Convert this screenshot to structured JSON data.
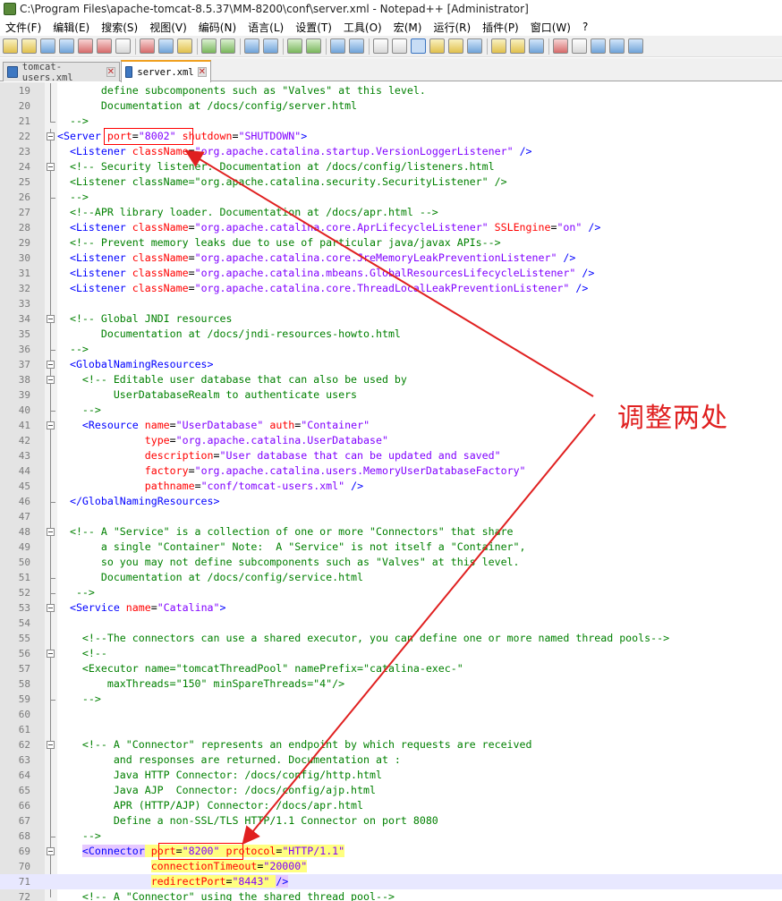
{
  "window": {
    "title": "C:\\Program Files\\apache-tomcat-8.5.37\\MM-8200\\conf\\server.xml - Notepad++ [Administrator]"
  },
  "menu": [
    "文件(F)",
    "编辑(E)",
    "搜索(S)",
    "视图(V)",
    "编码(N)",
    "语言(L)",
    "设置(T)",
    "工具(O)",
    "宏(M)",
    "运行(R)",
    "插件(P)",
    "窗口(W)",
    "?"
  ],
  "toolbar": {
    "icons": [
      "new-file-icon",
      "open-file-icon",
      "save-icon",
      "save-all-icon",
      "close-icon",
      "close-all-icon",
      "print-icon",
      "cut-icon",
      "copy-icon",
      "paste-icon",
      "undo-icon",
      "redo-icon",
      "find-icon",
      "replace-icon",
      "zoom-in-icon",
      "zoom-out-icon",
      "sync-vertical-icon",
      "sync-horizontal-icon",
      "word-wrap-icon",
      "show-all-chars-icon",
      "indent-guide-icon",
      "udl-icon",
      "doc-map-icon",
      "function-list-icon",
      "folder-workspace-icon",
      "monitoring-icon",
      "eye-icon",
      "record-macro-icon",
      "stop-macro-icon",
      "play-macro-icon",
      "run-macro-multiple-icon",
      "save-macro-icon"
    ]
  },
  "tabs": [
    {
      "label": "tomcat-users.xml",
      "active": false
    },
    {
      "label": "server.xml",
      "active": true
    }
  ],
  "editor": {
    "lines": [
      {
        "n": "19",
        "tokens": [
          {
            "t": "c",
            "v": "       define subcomponents such as \"Valves\" at this level."
          }
        ]
      },
      {
        "n": "20",
        "tokens": [
          {
            "t": "c",
            "v": "       Documentation at /docs/config/server.html"
          }
        ]
      },
      {
        "n": "21",
        "tokens": [
          {
            "t": "c",
            "v": "  -->"
          }
        ]
      },
      {
        "n": "22",
        "tokens": [
          {
            "t": "g",
            "v": "<Server"
          },
          {
            "t": "p",
            "v": " "
          },
          {
            "t": "a",
            "v": "port"
          },
          {
            "t": "p",
            "v": "="
          },
          {
            "t": "v",
            "v": "\"8002\""
          },
          {
            "t": "p",
            "v": " "
          },
          {
            "t": "a",
            "v": "shutdown"
          },
          {
            "t": "p",
            "v": "="
          },
          {
            "t": "v",
            "v": "\"SHUTDOWN\""
          },
          {
            "t": "g",
            "v": ">"
          }
        ]
      },
      {
        "n": "23",
        "tokens": [
          {
            "t": "p",
            "v": "  "
          },
          {
            "t": "g",
            "v": "<Listener"
          },
          {
            "t": "p",
            "v": " "
          },
          {
            "t": "a",
            "v": "className"
          },
          {
            "t": "p",
            "v": "="
          },
          {
            "t": "v",
            "v": "\"org.apache.catalina.startup.VersionLoggerListener\""
          },
          {
            "t": "p",
            "v": " "
          },
          {
            "t": "g",
            "v": "/>"
          }
        ]
      },
      {
        "n": "24",
        "tokens": [
          {
            "t": "c",
            "v": "  <!-- Security listener. Documentation at /docs/config/listeners.html"
          }
        ]
      },
      {
        "n": "25",
        "tokens": [
          {
            "t": "c",
            "v": "  <Listener className=\"org.apache.catalina.security.SecurityListener\" />"
          }
        ]
      },
      {
        "n": "26",
        "tokens": [
          {
            "t": "c",
            "v": "  -->"
          }
        ]
      },
      {
        "n": "27",
        "tokens": [
          {
            "t": "c",
            "v": "  <!--APR library loader. Documentation at /docs/apr.html -->"
          }
        ]
      },
      {
        "n": "28",
        "tokens": [
          {
            "t": "p",
            "v": "  "
          },
          {
            "t": "g",
            "v": "<Listener"
          },
          {
            "t": "p",
            "v": " "
          },
          {
            "t": "a",
            "v": "className"
          },
          {
            "t": "p",
            "v": "="
          },
          {
            "t": "v",
            "v": "\"org.apache.catalina.core.AprLifecycleListener\""
          },
          {
            "t": "p",
            "v": " "
          },
          {
            "t": "a",
            "v": "SSLEngine"
          },
          {
            "t": "p",
            "v": "="
          },
          {
            "t": "v",
            "v": "\"on\""
          },
          {
            "t": "p",
            "v": " "
          },
          {
            "t": "g",
            "v": "/>"
          }
        ]
      },
      {
        "n": "29",
        "tokens": [
          {
            "t": "c",
            "v": "  <!-- Prevent memory leaks due to use of particular java/javax APIs-->"
          }
        ]
      },
      {
        "n": "30",
        "tokens": [
          {
            "t": "p",
            "v": "  "
          },
          {
            "t": "g",
            "v": "<Listener"
          },
          {
            "t": "p",
            "v": " "
          },
          {
            "t": "a",
            "v": "className"
          },
          {
            "t": "p",
            "v": "="
          },
          {
            "t": "v",
            "v": "\"org.apache.catalina.core.JreMemoryLeakPreventionListener\""
          },
          {
            "t": "p",
            "v": " "
          },
          {
            "t": "g",
            "v": "/>"
          }
        ]
      },
      {
        "n": "31",
        "tokens": [
          {
            "t": "p",
            "v": "  "
          },
          {
            "t": "g",
            "v": "<Listener"
          },
          {
            "t": "p",
            "v": " "
          },
          {
            "t": "a",
            "v": "className"
          },
          {
            "t": "p",
            "v": "="
          },
          {
            "t": "v",
            "v": "\"org.apache.catalina.mbeans.GlobalResourcesLifecycleListener\""
          },
          {
            "t": "p",
            "v": " "
          },
          {
            "t": "g",
            "v": "/>"
          }
        ]
      },
      {
        "n": "32",
        "tokens": [
          {
            "t": "p",
            "v": "  "
          },
          {
            "t": "g",
            "v": "<Listener"
          },
          {
            "t": "p",
            "v": " "
          },
          {
            "t": "a",
            "v": "className"
          },
          {
            "t": "p",
            "v": "="
          },
          {
            "t": "v",
            "v": "\"org.apache.catalina.core.ThreadLocalLeakPreventionListener\""
          },
          {
            "t": "p",
            "v": " "
          },
          {
            "t": "g",
            "v": "/>"
          }
        ]
      },
      {
        "n": "33",
        "tokens": []
      },
      {
        "n": "34",
        "tokens": [
          {
            "t": "c",
            "v": "  <!-- Global JNDI resources"
          }
        ]
      },
      {
        "n": "35",
        "tokens": [
          {
            "t": "c",
            "v": "       Documentation at /docs/jndi-resources-howto.html"
          }
        ]
      },
      {
        "n": "36",
        "tokens": [
          {
            "t": "c",
            "v": "  -->"
          }
        ]
      },
      {
        "n": "37",
        "tokens": [
          {
            "t": "p",
            "v": "  "
          },
          {
            "t": "g",
            "v": "<GlobalNamingResources>"
          }
        ]
      },
      {
        "n": "38",
        "tokens": [
          {
            "t": "c",
            "v": "    <!-- Editable user database that can also be used by"
          }
        ]
      },
      {
        "n": "39",
        "tokens": [
          {
            "t": "c",
            "v": "         UserDatabaseRealm to authenticate users"
          }
        ]
      },
      {
        "n": "40",
        "tokens": [
          {
            "t": "c",
            "v": "    -->"
          }
        ]
      },
      {
        "n": "41",
        "tokens": [
          {
            "t": "p",
            "v": "    "
          },
          {
            "t": "g",
            "v": "<Resource"
          },
          {
            "t": "p",
            "v": " "
          },
          {
            "t": "a",
            "v": "name"
          },
          {
            "t": "p",
            "v": "="
          },
          {
            "t": "v",
            "v": "\"UserDatabase\""
          },
          {
            "t": "p",
            "v": " "
          },
          {
            "t": "a",
            "v": "auth"
          },
          {
            "t": "p",
            "v": "="
          },
          {
            "t": "v",
            "v": "\"Container\""
          }
        ]
      },
      {
        "n": "42",
        "tokens": [
          {
            "t": "p",
            "v": "              "
          },
          {
            "t": "a",
            "v": "type"
          },
          {
            "t": "p",
            "v": "="
          },
          {
            "t": "v",
            "v": "\"org.apache.catalina.UserDatabase\""
          }
        ]
      },
      {
        "n": "43",
        "tokens": [
          {
            "t": "p",
            "v": "              "
          },
          {
            "t": "a",
            "v": "description"
          },
          {
            "t": "p",
            "v": "="
          },
          {
            "t": "v",
            "v": "\"User database that can be updated and saved\""
          }
        ]
      },
      {
        "n": "44",
        "tokens": [
          {
            "t": "p",
            "v": "              "
          },
          {
            "t": "a",
            "v": "factory"
          },
          {
            "t": "p",
            "v": "="
          },
          {
            "t": "v",
            "v": "\"org.apache.catalina.users.MemoryUserDatabaseFactory\""
          }
        ]
      },
      {
        "n": "45",
        "tokens": [
          {
            "t": "p",
            "v": "              "
          },
          {
            "t": "a",
            "v": "pathname"
          },
          {
            "t": "p",
            "v": "="
          },
          {
            "t": "v",
            "v": "\"conf/tomcat-users.xml\""
          },
          {
            "t": "p",
            "v": " "
          },
          {
            "t": "g",
            "v": "/>"
          }
        ]
      },
      {
        "n": "46",
        "tokens": [
          {
            "t": "p",
            "v": "  "
          },
          {
            "t": "g",
            "v": "</GlobalNamingResources>"
          }
        ]
      },
      {
        "n": "47",
        "tokens": []
      },
      {
        "n": "48",
        "tokens": [
          {
            "t": "c",
            "v": "  <!-- A \"Service\" is a collection of one or more \"Connectors\" that share"
          }
        ]
      },
      {
        "n": "49",
        "tokens": [
          {
            "t": "c",
            "v": "       a single \"Container\" Note:  A \"Service\" is not itself a \"Container\","
          }
        ]
      },
      {
        "n": "50",
        "tokens": [
          {
            "t": "c",
            "v": "       so you may not define subcomponents such as \"Valves\" at this level."
          }
        ]
      },
      {
        "n": "51",
        "tokens": [
          {
            "t": "c",
            "v": "       Documentation at /docs/config/service.html"
          }
        ]
      },
      {
        "n": "52",
        "tokens": [
          {
            "t": "c",
            "v": "   -->"
          }
        ]
      },
      {
        "n": "53",
        "tokens": [
          {
            "t": "p",
            "v": "  "
          },
          {
            "t": "g",
            "v": "<Service"
          },
          {
            "t": "p",
            "v": " "
          },
          {
            "t": "a",
            "v": "name"
          },
          {
            "t": "p",
            "v": "="
          },
          {
            "t": "v",
            "v": "\"Catalina\""
          },
          {
            "t": "g",
            "v": ">"
          }
        ]
      },
      {
        "n": "54",
        "tokens": []
      },
      {
        "n": "55",
        "tokens": [
          {
            "t": "c",
            "v": "    <!--The connectors can use a shared executor, you can define one or more named thread pools-->"
          }
        ]
      },
      {
        "n": "56",
        "tokens": [
          {
            "t": "c",
            "v": "    <!--"
          }
        ]
      },
      {
        "n": "57",
        "tokens": [
          {
            "t": "c",
            "v": "    <Executor name=\"tomcatThreadPool\" namePrefix=\"catalina-exec-\""
          }
        ]
      },
      {
        "n": "58",
        "tokens": [
          {
            "t": "c",
            "v": "        maxThreads=\"150\" minSpareThreads=\"4\"/>"
          }
        ]
      },
      {
        "n": "59",
        "tokens": [
          {
            "t": "c",
            "v": "    -->"
          }
        ]
      },
      {
        "n": "60",
        "tokens": []
      },
      {
        "n": "61",
        "tokens": []
      },
      {
        "n": "62",
        "tokens": [
          {
            "t": "c",
            "v": "    <!-- A \"Connector\" represents an endpoint by which requests are received"
          }
        ]
      },
      {
        "n": "63",
        "tokens": [
          {
            "t": "c",
            "v": "         and responses are returned. Documentation at :"
          }
        ]
      },
      {
        "n": "64",
        "tokens": [
          {
            "t": "c",
            "v": "         Java HTTP Connector: /docs/config/http.html"
          }
        ]
      },
      {
        "n": "65",
        "tokens": [
          {
            "t": "c",
            "v": "         Java AJP  Connector: /docs/config/ajp.html"
          }
        ]
      },
      {
        "n": "66",
        "tokens": [
          {
            "t": "c",
            "v": "         APR (HTTP/AJP) Connector: /docs/apr.html"
          }
        ]
      },
      {
        "n": "67",
        "tokens": [
          {
            "t": "c",
            "v": "         Define a non-SSL/TLS HTTP/1.1 Connector on port 8080"
          }
        ]
      },
      {
        "n": "68",
        "tokens": [
          {
            "t": "c",
            "v": "    -->"
          }
        ]
      },
      {
        "n": "69",
        "tokens": [
          {
            "t": "p",
            "v": "    "
          },
          {
            "t": "G",
            "v": "<Connector"
          },
          {
            "t": "h",
            "v": " "
          },
          {
            "t": "A",
            "v": "port"
          },
          {
            "t": "h",
            "v": "="
          },
          {
            "t": "V",
            "v": "\"8200\""
          },
          {
            "t": "h",
            "v": " "
          },
          {
            "t": "A",
            "v": "protocol"
          },
          {
            "t": "h",
            "v": "="
          },
          {
            "t": "V",
            "v": "\"HTTP/1.1\""
          }
        ]
      },
      {
        "n": "70",
        "tokens": [
          {
            "t": "p",
            "v": "               "
          },
          {
            "t": "A",
            "v": "connectionTimeout"
          },
          {
            "t": "h",
            "v": "="
          },
          {
            "t": "V",
            "v": "\"20000\""
          }
        ]
      },
      {
        "n": "71",
        "tokens": [
          {
            "t": "p",
            "v": "               "
          },
          {
            "t": "A",
            "v": "redirectPort"
          },
          {
            "t": "h",
            "v": "="
          },
          {
            "t": "V",
            "v": "\"8443\""
          },
          {
            "t": "h",
            "v": " "
          },
          {
            "t": "G",
            "v": "/>"
          }
        ]
      },
      {
        "n": "72",
        "tokens": [
          {
            "t": "c",
            "v": "    <!-- A \"Connector\" using the shared thread pool-->"
          }
        ]
      }
    ],
    "current_line": "71"
  },
  "annotation": {
    "label": "调整两处",
    "color": "#e02020"
  },
  "colors": {
    "comment": "#008000",
    "tag": "#0000ff",
    "attribute": "#ff0000",
    "value": "#8000ff",
    "highlight": "#ffff80",
    "current_line": "#e8e8ff"
  }
}
